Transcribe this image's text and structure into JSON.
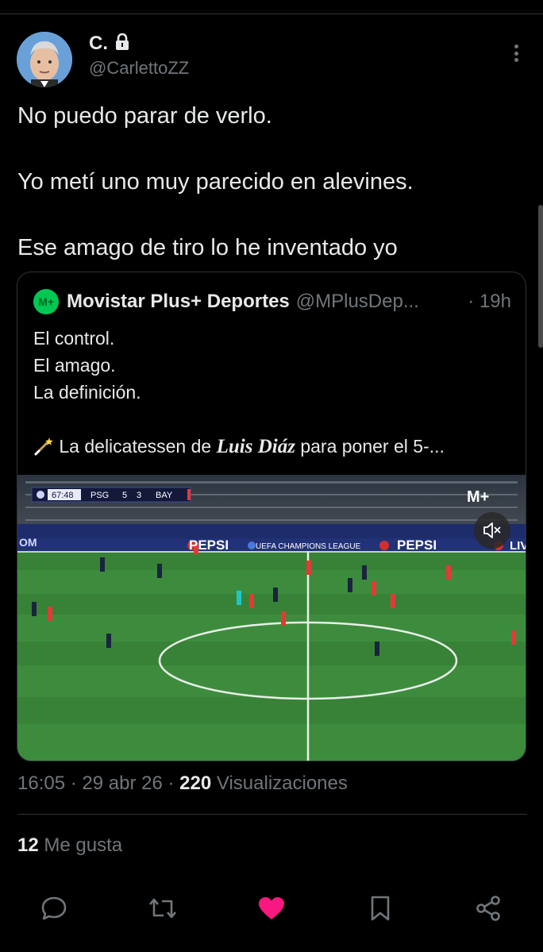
{
  "author": {
    "name": "C.",
    "handle": "@CarlettoZZ",
    "locked_icon": "lock-icon",
    "avatar": "avatar"
  },
  "tweet": {
    "lines": [
      "No puedo parar de verlo.",
      "",
      "Yo metí uno muy parecido en alevines.",
      "",
      "Ese amago de tiro lo he inventado yo"
    ]
  },
  "quote": {
    "logo_text": "M+",
    "name": "Movistar Plus+ Deportes",
    "handle": "@MPlusDep...",
    "time": "· 19h",
    "lines": [
      "El control.",
      "El amago.",
      "La definición."
    ],
    "last_line_pre": " La delicatessen de ",
    "last_line_emph": "Luis Diáz",
    "last_line_post": " para poner el 5-...",
    "wand_icon": "magic-wand-icon",
    "video": {
      "clock": "67:48",
      "home": "PSG",
      "home_score": "5",
      "away_score": "3",
      "away": "BAY",
      "channel_logo": "M+",
      "board_text_1": "PEPSI",
      "board_text_2": "UEFA CHAMPIONS LEAGUE",
      "board_text_3": "PEPSI",
      "board_edge_left": "OM",
      "board_edge_right": "LIV",
      "mute_icon": "volume-muted-icon"
    }
  },
  "meta": {
    "time": "16:05",
    "date": "29 abr 26",
    "sep": "·",
    "views": "220",
    "views_label": "Visualizaciones"
  },
  "likes": {
    "count": "12",
    "label": "Me gusta"
  },
  "colors": {
    "background": "#000000",
    "text": "#e7e9ea",
    "muted": "#71767b",
    "like": "#f91880",
    "pitch": "#3c8a3c"
  }
}
